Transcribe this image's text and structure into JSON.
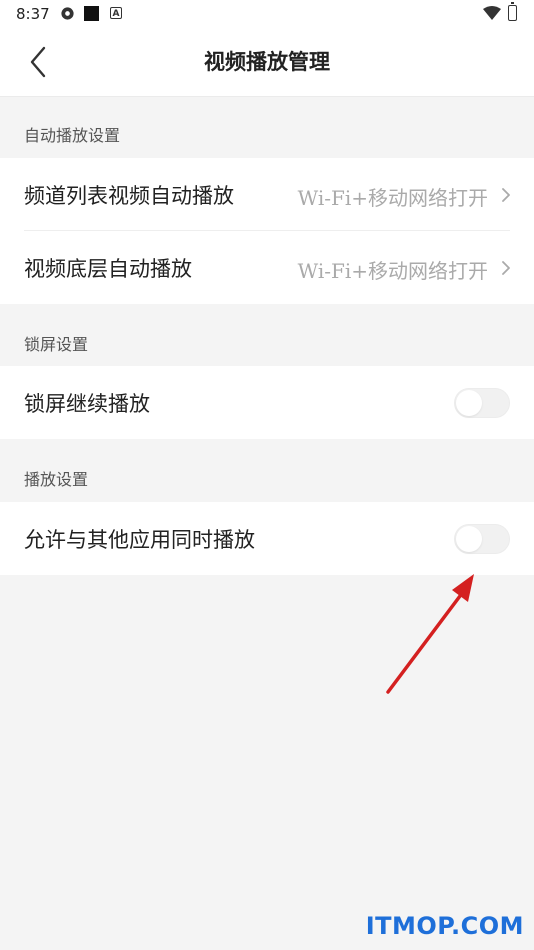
{
  "status_bar": {
    "time": "8:37"
  },
  "header": {
    "title": "视频播放管理"
  },
  "sections": [
    {
      "label": "自动播放设置",
      "rows": [
        {
          "label": "频道列表视频自动播放",
          "value": "Wi-Fi+移动网络打开"
        },
        {
          "label": "视频底层自动播放",
          "value": "Wi-Fi+移动网络打开"
        }
      ]
    },
    {
      "label": "锁屏设置",
      "rows": [
        {
          "label": "锁屏继续播放",
          "toggle_on": false
        }
      ]
    },
    {
      "label": "播放设置",
      "rows": [
        {
          "label": "允许与其他应用同时播放",
          "toggle_on": false
        }
      ]
    }
  ],
  "colors": {
    "annotation_arrow": "#d42020",
    "watermark": "#1e6fd9"
  },
  "watermark": "ITMOP.COM"
}
